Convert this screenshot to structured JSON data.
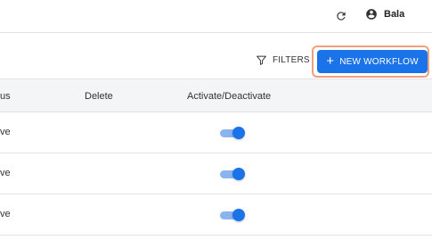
{
  "header": {
    "user_name": "Bala",
    "refresh_icon": "refresh-icon",
    "user_icon": "account-circle-icon"
  },
  "toolbar": {
    "filters_label": "FILTERS",
    "filter_icon": "filter-icon",
    "new_workflow_label": "NEW WORKFLOW",
    "new_workflow_icon": "plus-icon",
    "accent_color": "#1a73e8",
    "highlight_color": "#f0a07f"
  },
  "table": {
    "columns": [
      "us",
      "Delete",
      "Activate/Deactivate"
    ],
    "rows": [
      {
        "status": "ve",
        "active": true
      },
      {
        "status": "ve",
        "active": true
      },
      {
        "status": "ve",
        "active": true
      }
    ]
  }
}
